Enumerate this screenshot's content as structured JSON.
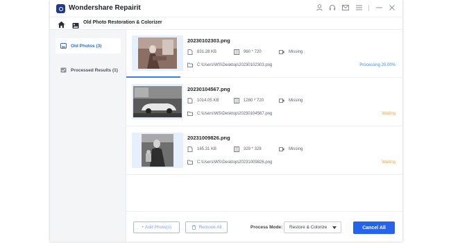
{
  "app": {
    "title": "Wondershare Repairit"
  },
  "nav": {
    "title": "Old Photo Restoration & Colorizer"
  },
  "titlebar_icons": [
    "user-icon",
    "headset-icon",
    "mail-icon",
    "menu-icon",
    "minimize-icon",
    "close-icon"
  ],
  "sidebar": {
    "items": [
      {
        "label": "Old Photos (3)",
        "icon": "photo-icon",
        "active": true
      },
      {
        "label": "Processed Results (1)",
        "icon": "results-icon",
        "active": false
      }
    ]
  },
  "files": [
    {
      "name": "20230102303.png",
      "size": "831.28 KB",
      "resolution": "960 * 720",
      "audio": "Missing",
      "path": "C:\\Users\\WS\\Desktop\\20230102303.png",
      "status": "Processing 20.00%",
      "status_color": "#3a8fe0"
    },
    {
      "name": "20230104567.png",
      "size": "1014.05 KB",
      "resolution": "1280 * 720",
      "audio": "Missing",
      "path": "C:\\Users\\WS\\Desktop\\20230104567.png",
      "status": "Waiting",
      "status_color": "#f0a33a"
    },
    {
      "name": "20231009826.png",
      "size": "185.31 KB",
      "resolution": "329 * 328",
      "audio": "Missing",
      "path": "C:\\Users\\WS\\Desktop\\20231009826.png",
      "status": "Waiting",
      "status_color": "#f0a33a"
    }
  ],
  "footer": {
    "add_label": "+ Add Photo(s)",
    "remove_label": "Remove All",
    "process_mode_label": "Process Mode:",
    "process_mode_value": "Restore & Colorize",
    "cancel_label": "Cancel All"
  },
  "colors": {
    "accent": "#2563eb",
    "processing": "#3a8fe0",
    "waiting": "#f0a33a"
  }
}
